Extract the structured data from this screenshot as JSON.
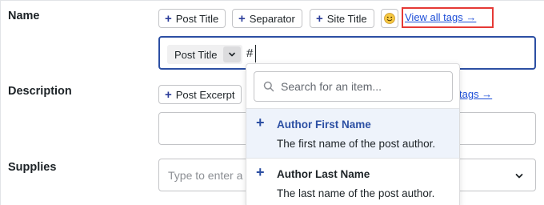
{
  "labels": {
    "name": "Name",
    "description": "Description",
    "supplies": "Supplies"
  },
  "name_tags": [
    {
      "label": "Post Title"
    },
    {
      "label": "Separator"
    },
    {
      "label": "Site Title"
    }
  ],
  "view_all_tags": "View all tags →",
  "name_input": {
    "chip_label": "Post Title",
    "typed_text": "#"
  },
  "description_tags": [
    {
      "label": "Post Excerpt"
    }
  ],
  "description_link_partial": "tags →",
  "supplies_input": {
    "placeholder": "Type to enter a"
  },
  "dropdown": {
    "search_placeholder": "Search for an item...",
    "items": [
      {
        "title": "Author First Name",
        "description": "The first name of the post author."
      },
      {
        "title": "Author Last Name",
        "description": "The last name of the post author."
      }
    ]
  },
  "colors": {
    "accent_blue": "#2c4fa3",
    "link_blue": "#1d4ed8",
    "highlight_red": "#e53935",
    "active_item_bg": "#eef3fb"
  },
  "icons": {
    "plus": "+",
    "chevron": "chevron-down-icon",
    "search": "search-icon",
    "emoji": "smiley-emoji-icon"
  }
}
